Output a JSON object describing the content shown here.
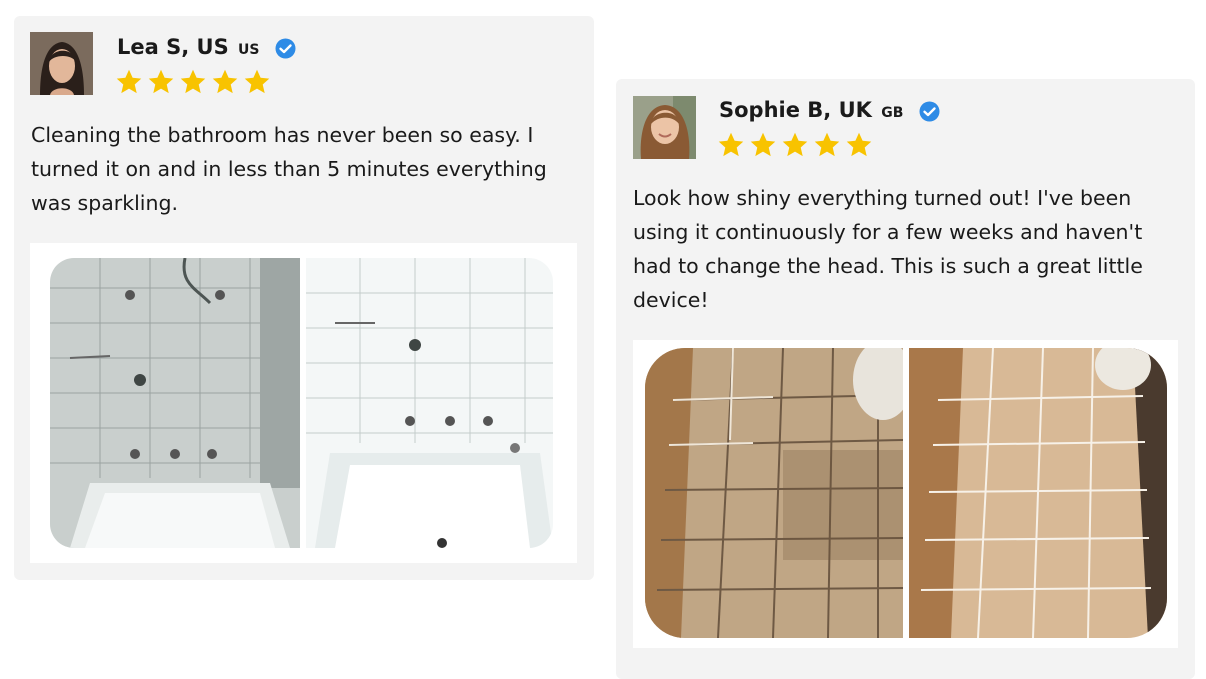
{
  "reviews": [
    {
      "reviewer": "Lea S, US",
      "country_code": "US",
      "rating": 5,
      "verified": true,
      "text": "Cleaning the bathroom has never been so easy. I turned it on and in less than 5 minutes everything was sparkling.",
      "photo": "before-after-bathtub-photo"
    },
    {
      "reviewer": "Sophie B, UK",
      "country_code": "GB",
      "rating": 5,
      "verified": true,
      "text": "Look how shiny everything turned out! I've been using it continuously for a few weeks and haven't had to change the head. This is such a great little device!",
      "photo": "before-after-floor-tiles-photo"
    }
  ],
  "colors": {
    "star": "#f8c300",
    "verified": "#2e8be6",
    "card_bg": "#f3f3f3"
  }
}
